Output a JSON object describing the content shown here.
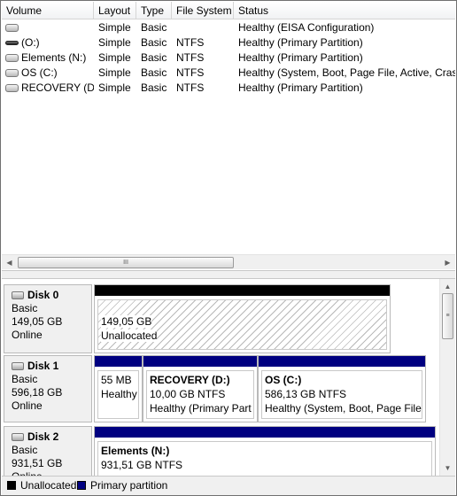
{
  "columns": [
    "Volume",
    "Layout",
    "Type",
    "File System",
    "Status"
  ],
  "volumes": [
    {
      "name": "",
      "layout": "Simple",
      "type": "Basic",
      "fs": "",
      "status": "Healthy (EISA Configuration)",
      "icon": "drive-icon"
    },
    {
      "name": "(O:)",
      "layout": "Simple",
      "type": "Basic",
      "fs": "NTFS",
      "status": "Healthy (Primary Partition)",
      "icon": "removable-drive-icon"
    },
    {
      "name": "Elements (N:)",
      "layout": "Simple",
      "type": "Basic",
      "fs": "NTFS",
      "status": "Healthy (Primary Partition)",
      "icon": "drive-icon"
    },
    {
      "name": "OS (C:)",
      "layout": "Simple",
      "type": "Basic",
      "fs": "NTFS",
      "status": "Healthy (System, Boot, Page File, Active, Crash",
      "icon": "drive-icon"
    },
    {
      "name": "RECOVERY (D:)",
      "layout": "Simple",
      "type": "Basic",
      "fs": "NTFS",
      "status": "Healthy (Primary Partition)",
      "icon": "drive-icon"
    }
  ],
  "hscroll_grip": "III",
  "vscroll_grip": "≡",
  "disks": [
    {
      "name": "Disk 0",
      "type": "Basic",
      "size": "149,05 GB",
      "state": "Online",
      "partitions": [
        {
          "name": "",
          "size": "149,05 GB",
          "detail": "Unallocated",
          "kind": "unallocated"
        }
      ]
    },
    {
      "name": "Disk 1",
      "type": "Basic",
      "size": "596,18 GB",
      "state": "Online",
      "partitions": [
        {
          "name": "",
          "size": "55 MB",
          "detail": "Healthy",
          "kind": "primary"
        },
        {
          "name": "RECOVERY  (D:)",
          "size": "10,00 GB NTFS",
          "detail": "Healthy (Primary Part",
          "kind": "primary"
        },
        {
          "name": "OS  (C:)",
          "size": "586,13 GB NTFS",
          "detail": "Healthy (System, Boot, Page File,",
          "kind": "primary"
        }
      ]
    },
    {
      "name": "Disk 2",
      "type": "Basic",
      "size": "931,51 GB",
      "state": "Online",
      "partitions": [
        {
          "name": "Elements  (N:)",
          "size": "931,51 GB NTFS",
          "detail": "",
          "kind": "primary"
        }
      ]
    }
  ],
  "legend": [
    {
      "label": "Unallocated",
      "color": "#000000"
    },
    {
      "label": "Primary partition",
      "color": "#000080"
    }
  ],
  "colors": {
    "primary": "#000080",
    "unallocated": "#000000"
  }
}
